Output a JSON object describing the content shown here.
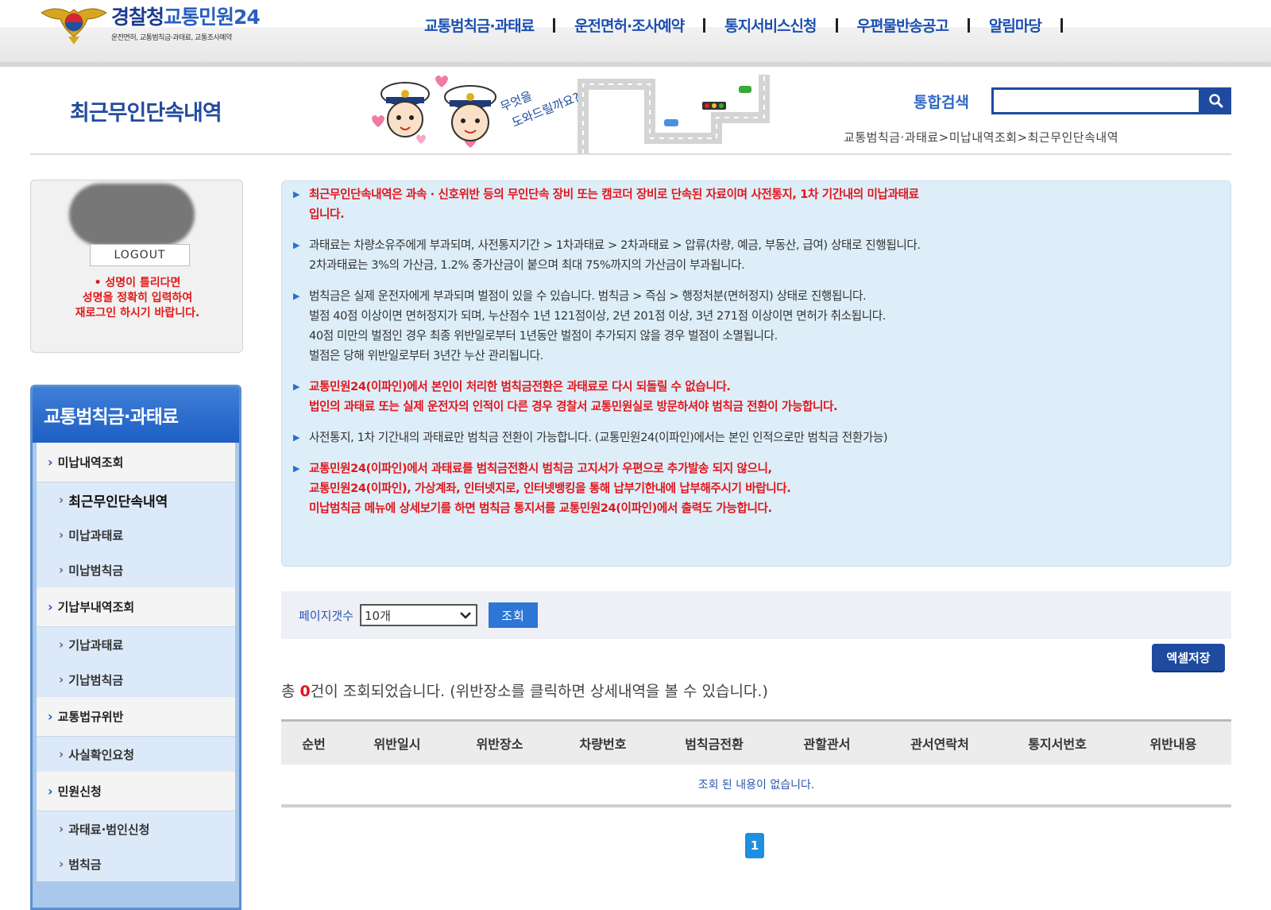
{
  "header": {
    "logo_title_1": "경찰청",
    "logo_title_2": "교통민원24",
    "logo_sub": "운전면허, 교통범칙금·과태료, 교통조사예약",
    "nav": [
      "교통범칙금·과태료",
      "운전면허·조사예약",
      "통지서비스신청",
      "우편물반송공고",
      "알림마당"
    ]
  },
  "page_title": "최근무인단속내역",
  "mascot_text_1": "무엇을",
  "mascot_text_2": "도와드릴까요?",
  "search": {
    "label": "통합검색",
    "value": ""
  },
  "breadcrumb": "교통범칙금·과태료>미납내역조회>최근무인단속내역",
  "login": {
    "logout_label": "LOGOUT",
    "note": [
      "• 성명이 틀리다면",
      "성명을 정확히 입력하여",
      "재로그인 하시기 바랍니다."
    ]
  },
  "lnb": {
    "title": "교통범칙금·과태료",
    "items": [
      {
        "level": 1,
        "label": "미납내역조회"
      },
      {
        "level": 2,
        "label": "최근무인단속내역",
        "active": true
      },
      {
        "level": 2,
        "label": "미납과태료"
      },
      {
        "level": 2,
        "label": "미납범칙금"
      },
      {
        "level": 1,
        "label": "기납부내역조회"
      },
      {
        "level": 2,
        "label": "기납과태료"
      },
      {
        "level": 2,
        "label": "기납범칙금"
      },
      {
        "level": 1,
        "label": "교통법규위반"
      },
      {
        "level": 2,
        "label": "사실확인요청"
      },
      {
        "level": 1,
        "label": "민원신청"
      },
      {
        "level": 2,
        "label": "과태료·범인신청"
      },
      {
        "level": 2,
        "label": "범칙금"
      }
    ]
  },
  "notice": [
    {
      "style": "red",
      "lines": [
        "최근무인단속내역은 과속 · 신호위반 등의 무인단속 장비 또는 캠코더 장비로 단속된 자료이며 사전통지, 1차 기간내의 미납과태료",
        "입니다."
      ]
    },
    {
      "style": "black",
      "lines": [
        "과태료는 차량소유주에게 부과되며, 사전통지기간 > 1차과태료 > 2차과태료 > 압류(차량, 예금, 부동산, 급여) 상태로 진행됩니다.",
        "2차과태료는 3%의 가산금, 1.2% 중가산금이 붙으며 최대 75%까지의 가산금이 부과됩니다."
      ]
    },
    {
      "style": "black",
      "lines": [
        "범칙금은 실제 운전자에게 부과되며 벌점이 있을 수 있습니다. 범칙금 > 즉심 > 행정처분(면허정지) 상태로 진행됩니다.",
        "벌점 40점 이상이면 면허정지가 되며, 누산점수 1년 121점이상, 2년 201점 이상, 3년 271점 이상이면 면허가 취소됩니다.",
        "40점 미만의 벌점인 경우 최종 위반일로부터 1년동안 벌점이 추가되지 않을 경우 벌점이 소멸됩니다.",
        "벌점은 당해 위반일로부터 3년간 누산 관리됩니다."
      ]
    },
    {
      "style": "red",
      "lines": [
        "교통민원24(이파인)에서 본인이 처리한 범칙금전환은 과태료로 다시 되돌릴 수 없습니다.",
        "법인의 과태료 또는 실제 운전자의 인적이 다른 경우 경찰서 교통민원실로 방문하셔야 범칙금 전환이 가능합니다."
      ]
    },
    {
      "style": "black",
      "lines": [
        "사전통지, 1차 기간내의 과태료만 범칙금 전환이 가능합니다. (교통민원24(이파인)에서는 본인 인적으로만 범칙금 전환가능)"
      ]
    },
    {
      "style": "red",
      "lines": [
        "교통민원24(이파인)에서 과태료를 범칙금전환시 범칙금 고지서가 우편으로 추가발송 되지 않으니,",
        "교통민원24(이파인), 가상계좌, 인터넷지로, 인터넷뱅킹을 통해 납부기한내에 납부해주시기 바랍니다.",
        "미납범칙금 메뉴에 상세보기를 하면 범칙금 통지서를 교통민원24(이파인)에서 출력도 가능합니다."
      ]
    }
  ],
  "filter": {
    "label": "페이지갯수",
    "select_value": "10개",
    "query_label": "조회"
  },
  "excel_label": "엑셀저장",
  "result": {
    "prefix": "총 ",
    "count": "0",
    "suffix": "건이 조회되었습니다. (위반장소를 클릭하면 상세내역을 볼 수 있습니다.)"
  },
  "table": {
    "columns": [
      "순번",
      "위반일시",
      "위반장소",
      "차량번호",
      "범칙금전환",
      "관할관서",
      "관서연락처",
      "통지서번호",
      "위반내용"
    ],
    "empty_text": "조회 된 내용이 없습니다."
  },
  "pagination": {
    "current": "1"
  },
  "colors": {
    "brand_blue": "#1e4aa0",
    "alert_red": "#e2151b",
    "notice_bg": "#ddeef8"
  }
}
